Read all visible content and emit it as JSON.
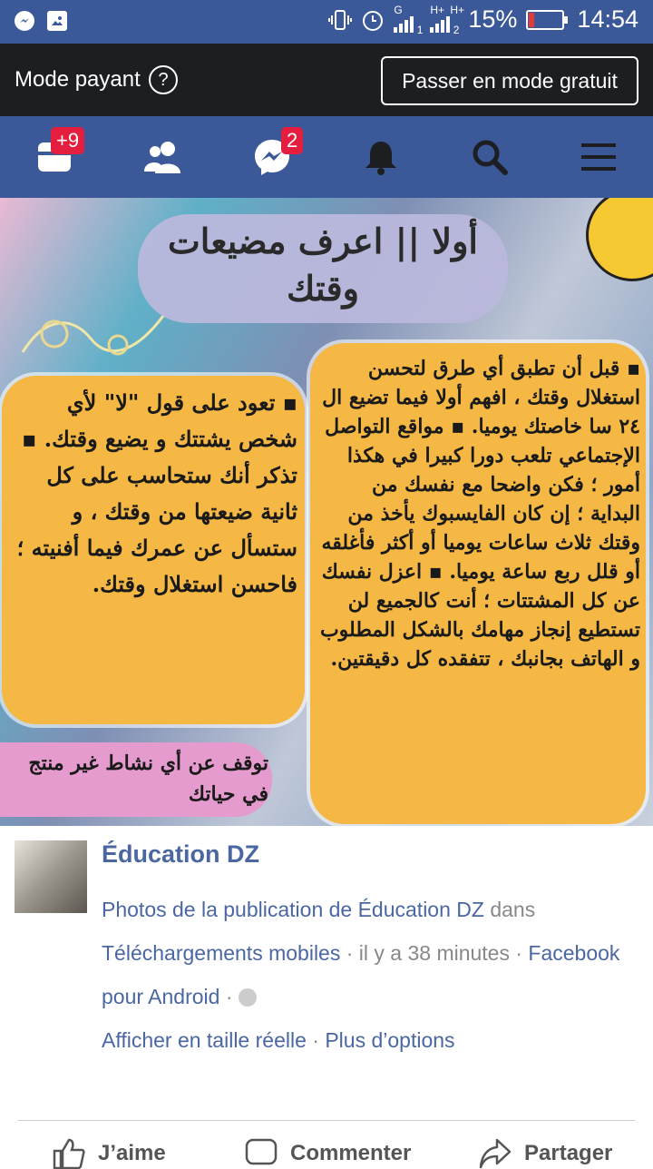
{
  "status_bar": {
    "battery_percent": "15%",
    "time": "14:54",
    "sim1": "1",
    "sim2": "2",
    "net1": "G",
    "net2": "H+",
    "net3": "H+",
    "battery_level": 0.15
  },
  "mode_bar": {
    "label": "Mode payant",
    "help": "?",
    "button": "Passer en mode gratuit"
  },
  "nav": {
    "items": [
      {
        "icon": "news-feed-icon",
        "badge": "+9"
      },
      {
        "icon": "friends-icon",
        "badge": ""
      },
      {
        "icon": "messenger-icon",
        "badge": "2"
      },
      {
        "icon": "bell-icon",
        "badge": ""
      },
      {
        "icon": "search-icon",
        "badge": ""
      },
      {
        "icon": "menu-icon",
        "badge": ""
      }
    ]
  },
  "image": {
    "title": "أولا || اعرف مضيعات وقتك",
    "right_text": "▪ قبل أن تطبق أي طرق لتحسن استغلال وقتك ، افهم أولا فيما تضيع ال ٢٤ سا خاصتك يوميا. ▪ مواقع التواصل الإجتماعي تلعب دورا كبيرا في هكذا أمور ؛ فكن واضحا مع نفسك من البداية ؛ إن كان الفايسبوك يأخذ من وقتك ثلاث ساعات يوميا أو أكثر فأغلقه أو قلل ربع ساعة يوميا. ▪ اعزل نفسك عن كل المشتتات ؛ أنت كالجميع لن تستطيع إنجاز مهامك بالشكل المطلوب و الهاتف بجانبك ، تتفقده كل دقيقتين.",
    "left_text": "▪ تعود على قول \"لا\" لأي شخص يشتتك و يضيع وقتك. ▪ تذكر أنك ستحاسب على كل ثانية ضيعتها من وقتك ، و ستسأل عن عمرك فيما أفنيته ؛ فاحسن استغلال وقتك.",
    "bottom_text": "توقف عن أي نشاط غير منتج في حياتك"
  },
  "post": {
    "page_name": "Éducation DZ",
    "photos_link": "Photos de la publication de Éducation DZ",
    "in_word": " dans",
    "album_link": "Téléchargements mobiles",
    "time_text": " · il y a 38 minutes · ",
    "app_link": "Facebook pour Android",
    "sep": " · ",
    "full_size_link": "Afficher en taille réelle",
    "more_options_link": "Plus d’options"
  },
  "actions": {
    "like": "J’aime",
    "comment": "Commenter",
    "share": "Partager"
  },
  "colors": {
    "facebook_blue": "#3b5998",
    "link_blue": "#4b67a1",
    "badge_red": "#e41e3f",
    "card_yellow": "#f5b844",
    "pill_purple": "#b9b8dc",
    "pink_box": "#e59bcd"
  }
}
